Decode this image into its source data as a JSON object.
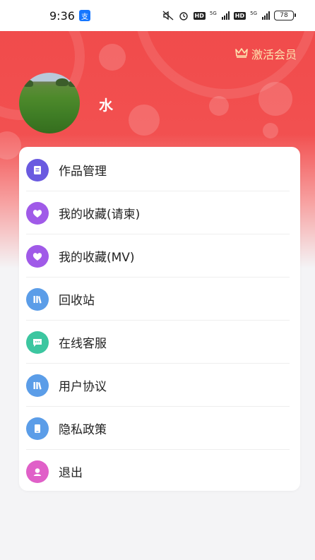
{
  "status_bar": {
    "time": "9:36",
    "app_icon": "alipay-icon",
    "battery": "78",
    "network": "5G"
  },
  "header": {
    "vip_label": "激活会员",
    "vip_icon": "crown-icon",
    "username": "水"
  },
  "colors": {
    "accent_red": "#f04a4a",
    "vip_gold": "#fde3b0"
  },
  "menu": [
    {
      "label": "作品管理",
      "icon": "document-icon",
      "color": "#6a5ae0"
    },
    {
      "label": "我的收藏(请柬)",
      "icon": "heart-icon",
      "color": "#a05ae8"
    },
    {
      "label": "我的收藏(MV)",
      "icon": "heart-icon",
      "color": "#a05ae8"
    },
    {
      "label": "回收站",
      "icon": "books-icon",
      "color": "#5b9de8"
    },
    {
      "label": "在线客服",
      "icon": "chat-icon",
      "color": "#3cc6a0"
    },
    {
      "label": "用户协议",
      "icon": "books-icon",
      "color": "#5b9de8"
    },
    {
      "label": "隐私政策",
      "icon": "tablet-icon",
      "color": "#5b9de8"
    },
    {
      "label": "退出",
      "icon": "logout-icon",
      "color": "#e060c8"
    }
  ]
}
